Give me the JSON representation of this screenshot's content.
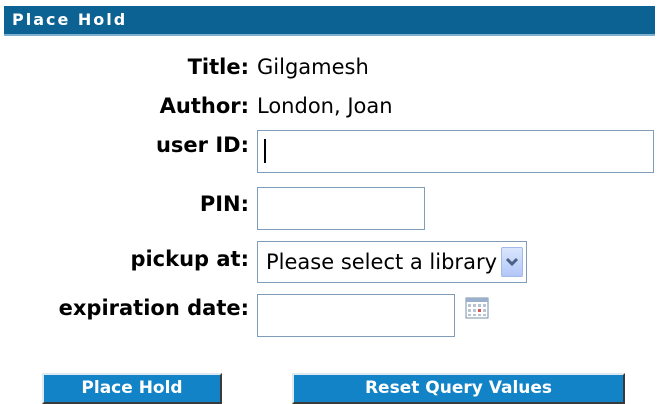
{
  "header": {
    "title": "Place Hold"
  },
  "fields": {
    "title_label": "Title:",
    "title_value": "Gilgamesh",
    "author_label": "Author:",
    "author_value": "London, Joan",
    "user_id_label": "user ID:",
    "user_id_value": "",
    "pin_label": "PIN:",
    "pin_value": "",
    "pickup_label": "pickup at:",
    "pickup_selected": "Please select a library",
    "expiration_label": "expiration date:",
    "expiration_value": ""
  },
  "icons": {
    "dropdown": "chevron-down-icon",
    "calendar": "calendar-icon"
  },
  "buttons": {
    "place_hold": "Place Hold",
    "reset": "Reset Query Values"
  },
  "colors": {
    "header_bg": "#0c6293",
    "button_bg": "#1283c6"
  }
}
